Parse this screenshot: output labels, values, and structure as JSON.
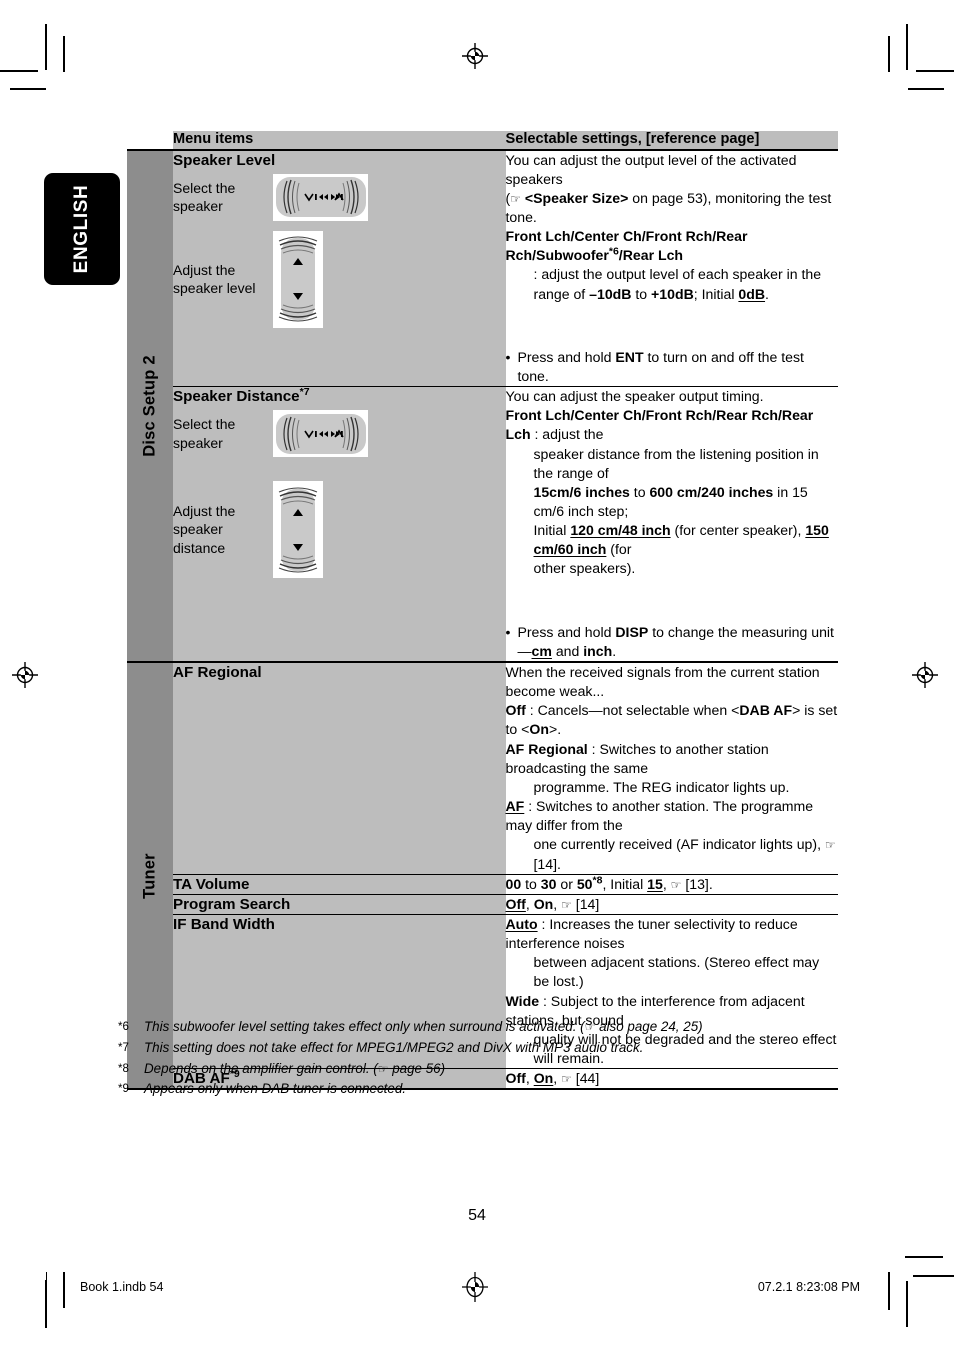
{
  "language_tab": "ENGLISH",
  "table": {
    "header": {
      "col1": "Menu items",
      "col2": "Selectable settings, [reference page]"
    },
    "categories": {
      "disc_setup": "Disc Setup 2",
      "tuner": "Tuner"
    },
    "rows": [
      {
        "title": "Speaker Level",
        "title_star": "",
        "steps": [
          {
            "label": "Select the speaker",
            "control": "horizontal-rocker-button"
          },
          {
            "label": "Adjust the speaker level",
            "control": "vertical-rocker-button"
          }
        ],
        "settings": {
          "line1": "You can adjust the output level of the activated speakers",
          "line2_pre": "(",
          "line2_icon": "pointing-hand-icon",
          "line2_bold": "<Speaker Size>",
          "line2_post": " on page 53), monitoring the test tone.",
          "options_bold": "Front Lch/Center Ch/Front Rch/Rear Rch/Subwoofer",
          "options_star": "*6",
          "options_bold2": "/Rear Lch",
          "desc_pre": ": adjust the output level of each speaker in the range of ",
          "desc_b1": "–10dB",
          "desc_mid": " to ",
          "desc_b2": "+10dB",
          "desc_mid2": "; Initial ",
          "desc_b3": "0dB",
          "desc_end": ".",
          "note_bullet": "•",
          "note_pre": "Press and hold ",
          "note_b": "ENT",
          "note_post": " to turn on and off the test tone."
        }
      },
      {
        "title": "Speaker Distance",
        "title_star": "*7",
        "steps": [
          {
            "label": "Select the speaker",
            "control": "horizontal-rocker-button"
          },
          {
            "label": "Adjust the speaker distance",
            "control": "vertical-rocker-button"
          }
        ],
        "settings": {
          "line1": "You can adjust the speaker output timing.",
          "options_bold": "Front Lch/Center Ch/Front Rch/Rear Rch/Rear Lch",
          "options_post": " : adjust the",
          "d_l1": "speaker distance from the listening position in the range of",
          "d_b1": "15cm/6 inches",
          "d_t1": " to ",
          "d_b2": "600 cm/240 inches",
          "d_t2": " in 15 cm/6 inch step;",
          "d_t3": "Initial ",
          "d_b3": "120 cm/48 inch",
          "d_t4": " (for center speaker), ",
          "d_b4": "150 cm/60 inch",
          "d_t5": " (for",
          "d_t6": "other speakers).",
          "note_bullet": "•",
          "note_pre": "Press and hold ",
          "note_b": "DISP",
          "note_mid": " to change the measuring unit—",
          "note_b2": "cm",
          "note_mid2": " and ",
          "note_b3": "inch",
          "note_end": "."
        }
      },
      {
        "title": "AF Regional",
        "title_star": "",
        "steps": [],
        "settings": {
          "line1": "When the received signals from the current station become weak...",
          "off_b": "Off",
          "off_t1": " : Cancels—not selectable when <",
          "off_b2": "DAB AF",
          "off_t2": "> is set to <",
          "off_b3": "On",
          "off_t3": ">.",
          "afr_b": "AF Regional",
          "afr_t": " : Switches to another station broadcasting the same",
          "afr_ind": "programme. The REG indicator lights up.",
          "af_b": "AF",
          "af_t": " : Switches to another station. The programme may differ from the",
          "af_ind_pre": "one currently received (AF indicator lights up), ",
          "af_icon": "pointing-hand-icon",
          "af_ind_post": " [14]."
        }
      },
      {
        "title": "TA Volume",
        "title_star": "",
        "steps": [],
        "settings": {
          "b1": "00",
          "t1": " to ",
          "b2": "30",
          "t2": " or ",
          "b3": "50",
          "s3": "*8",
          "t3": ", Initial ",
          "b4": "15",
          "t4": ", ",
          "icon": "pointing-hand-icon",
          "t5": " [13]."
        }
      },
      {
        "title": "Program Search",
        "title_star": "",
        "steps": [],
        "settings": {
          "b1": "Off",
          "t1": ", ",
          "b2": "On",
          "t2": ", ",
          "icon": "pointing-hand-icon",
          "t3": " [14]"
        }
      },
      {
        "title": "IF Band Width",
        "title_star": "",
        "steps": [],
        "settings": {
          "auto_b": "Auto",
          "auto_t": " : Increases the tuner selectivity to reduce interference noises",
          "auto_ind": "between adjacent stations. (Stereo effect may be lost.)",
          "wide_b": "Wide",
          "wide_t": " : Subject to the interference from adjacent stations, but sound",
          "wide_ind": "quality will not be degraded and the stereo effect will remain."
        }
      },
      {
        "title": "DAB AF",
        "title_star": "*9",
        "steps": [],
        "settings": {
          "b1": "Off",
          "t1": ", ",
          "b2": "On",
          "t2": ", ",
          "icon": "pointing-hand-icon",
          "t3": " [44]"
        }
      }
    ]
  },
  "footnotes": [
    {
      "mark": "*6",
      "text_pre": "This subwoofer level setting takes effect only when surround is activated. (",
      "icon": "pointing-hand-icon",
      "text_post": " also page 24, 25)"
    },
    {
      "mark": "*7",
      "text_pre": "This setting does not take effect for MPEG1/MPEG2 and DivX with MP3 audio track.",
      "icon": "",
      "text_post": ""
    },
    {
      "mark": "*8",
      "text_pre": "Depends on the amplifier gain control. (",
      "icon": "pointing-hand-icon",
      "text_post": " page 56)"
    },
    {
      "mark": "*9",
      "text_pre": "Appears only when DAB tuner is connected.",
      "icon": "",
      "text_post": ""
    }
  ],
  "page_number": "54",
  "print_bar": {
    "left": "Book 1.indb   54",
    "right": "07.2.1   8:23:08 PM",
    "mark": "registration-target-icon"
  },
  "colors": {
    "category_strip": "#8d8d8d",
    "menu_cell": "#bdbdbd",
    "header_row": "#bdbdbd",
    "button_face": "#c9c9c9",
    "rule": "#000000"
  }
}
